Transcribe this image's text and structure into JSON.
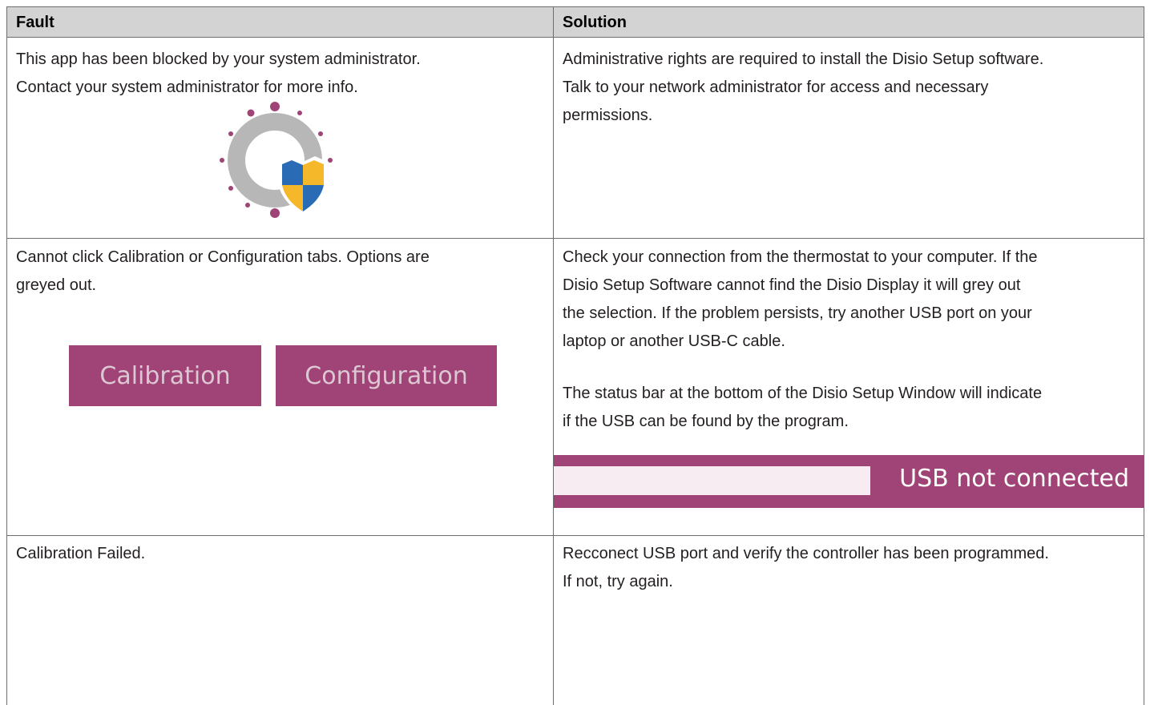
{
  "table": {
    "headers": {
      "fault": "Fault",
      "solution": "Solution"
    },
    "rows": [
      {
        "fault": [
          "This app has been blocked by your system administrator.",
          "Contact your system administrator for more info."
        ],
        "fault_image_icon": "admin-blocked-shield-icon",
        "solution": [
          "Administrative rights are required to install the Disio Setup software.",
          "Talk to your network administrator for access and necessary",
          "permissions."
        ]
      },
      {
        "fault": [
          "Cannot click Calibration or Configuration tabs. Options are",
          "greyed out."
        ],
        "tabs": [
          "Calibration",
          "Configuration"
        ],
        "solution": [
          "Check your connection from the thermostat to your computer. If the",
          "Disio Setup Software cannot find the Disio Display it will grey out",
          "the selection. If the problem persists, try another USB port on your",
          "laptop or another USB-C cable."
        ],
        "solution_2": [
          "The status bar at the bottom of the Disio Setup Window will indicate",
          "if the USB can be found by the program."
        ],
        "status_bar_text": "USB not connected"
      },
      {
        "fault": [
          "Calibration Failed."
        ],
        "solution": [
          "Recconect USB port and verify the controller has been programmed.",
          "If not, try again."
        ]
      }
    ]
  },
  "colors": {
    "header_bg": "#d3d3d3",
    "accent": "#a04376",
    "disabled_tab_text": "#dcc7d3",
    "status_field": "#f8ecf3",
    "shield_blue": "#2a6bb5",
    "shield_yellow": "#f5b82a",
    "ring_gray": "#b7b7b7"
  }
}
